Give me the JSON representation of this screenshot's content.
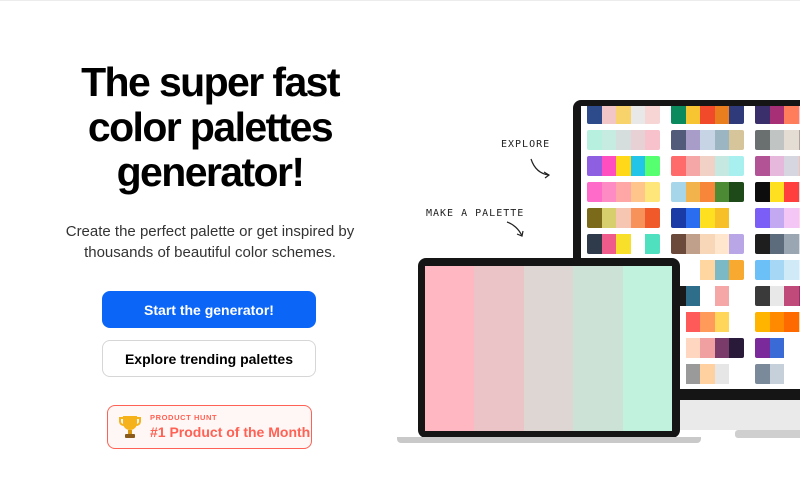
{
  "hero": {
    "title_lines": [
      "The super fast",
      "color palettes",
      "generator!"
    ],
    "subtitle_lines": [
      "Create the perfect palette or get inspired by",
      "thousands of beautiful color schemes."
    ]
  },
  "buttons": {
    "primary": "Start the generator!",
    "secondary": "Explore trending palettes"
  },
  "product_hunt": {
    "label": "PRODUCT HUNT",
    "title": "#1 Product of the Month"
  },
  "annotations": {
    "explore": "EXPLORE",
    "make": "MAKE A PALETTE"
  },
  "colors": {
    "primary_button": "#0b66f7",
    "product_hunt_accent": "#ff6154"
  },
  "laptop_palette": [
    "#ffb8c1",
    "#ebc4c8",
    "#ded6d2",
    "#cde2d7",
    "#c1f2de"
  ],
  "monitor_palettes": [
    [
      "#2d4a8a",
      "#f2c6c6",
      "#f8d26a",
      "#e8e8e8",
      "#f7d5d5"
    ],
    [
      "#0b8a5d",
      "#f7c532",
      "#f04a2a",
      "#e87e1e",
      "#2e3a7a"
    ],
    [
      "#3a2f6b",
      "#a72f75",
      "#ff7d5a",
      "#f0c7d7",
      "#ffe7a0"
    ],
    [
      "#b8f0e0",
      "#c6ece1",
      "#d5dedd",
      "#e8d1d5",
      "#f7c2cb"
    ],
    [
      "#525c7a",
      "#a89cc8",
      "#c6d4e6",
      "#9bb6c2",
      "#d6c49a"
    ],
    [
      "#6a7070",
      "#c0c5c4",
      "#e4ddd3",
      "#b2a39a",
      "#8d5a4c"
    ],
    [
      "#8e5fe0",
      "#ff4ec0",
      "#ffd81a",
      "#22c5e8",
      "#55ff70"
    ],
    [
      "#ff6b6b",
      "#f5a6a6",
      "#f1d0c5",
      "#c5e8e0",
      "#a8f0f0"
    ],
    [
      "#b25396",
      "#e6b9dc",
      "#d6d6e0",
      "#f3c2b7",
      "#f7eed0"
    ],
    [
      "#ff6bc9",
      "#ff8bc5",
      "#ffa6a6",
      "#ffc58a",
      "#ffe67a"
    ],
    [
      "#a6d6ea",
      "#f2b34d",
      "#f7863a",
      "#4c8a34",
      "#1e4a1a"
    ],
    [
      "#0d0d0d",
      "#ffe020",
      "#ff3e3e",
      "#d8d8d8",
      "#2e2e2e"
    ],
    [
      "#7a6a1a",
      "#d7cf6e",
      "#f6c6b3",
      "#f7925a",
      "#f05a2a"
    ],
    [
      "#1a3aa6",
      "#2a6df0",
      "#ffe020",
      "#f7c026",
      "#ffffff"
    ],
    [
      "#7b5ef5",
      "#c3a9f2",
      "#f3c6f5",
      "#ffd6f0",
      "#ff9ec9"
    ],
    [
      "#2f3a4a",
      "#ef5b8a",
      "#f8df2a",
      "#ffffff",
      "#4fe0c0"
    ],
    [
      "#6b4a3c",
      "#c0a08a",
      "#f8d6b8",
      "#ffe6cc",
      "#b9a6e6"
    ],
    [
      "#1e1e1e",
      "#5c6c7c",
      "#9aa6b2",
      "#d6dde3",
      "#ffffff"
    ],
    [
      "#ffffff",
      "#ffffff",
      "#ffb8c1",
      "#e0d6d2",
      "#c1f2de"
    ],
    [
      "#ffffff",
      "#ffffff",
      "#ffd6a0",
      "#7bb9c6",
      "#f7a930"
    ],
    [
      "#6ac0f7",
      "#a6d8f5",
      "#d0eaf7",
      "#e6f4fb",
      "#ffffff"
    ],
    [
      "#ffffff",
      "#ffffff",
      "#0b5a3a",
      "#e670a6",
      "#f3c0c0"
    ],
    [
      "#1a1a1a",
      "#2e6e8a",
      "#ffffff",
      "#f5a6a6",
      "#ffffff"
    ],
    [
      "#3a3a3a",
      "#e8e8e8",
      "#c04a7a",
      "#9e2a6a",
      "#ffffff"
    ],
    [
      "#ffffff",
      "#ffffff",
      "#f53a2a",
      "#f58a2a",
      "#ffd02a"
    ],
    [
      "#ffffff",
      "#ff5a5a",
      "#ff9a5a",
      "#ffd65a",
      "#ffffff"
    ],
    [
      "#ffb400",
      "#ff8a00",
      "#ff6a00",
      "#ffd6a0",
      "#ffffff"
    ],
    [
      "#ffffff",
      "#ffffff",
      "#ffc61a",
      "#2e4a9a",
      "#f7b0d0"
    ],
    [
      "#ffffff",
      "#ffd6c0",
      "#f0a0a0",
      "#7a3a6a",
      "#2a1a3a"
    ],
    [
      "#7a2a9a",
      "#3a6ad6",
      "#ffffff",
      "#ffffff",
      "#ffffff"
    ],
    [
      "#ffffff",
      "#ffffff",
      "#f0f0f0",
      "#9ae0f0",
      "#ffe6a0"
    ],
    [
      "#ffffff",
      "#9a9a9a",
      "#ffd0a0",
      "#e6e6e6",
      "#ffffff"
    ],
    [
      "#7a8a9a",
      "#c6d0da",
      "#ffffff",
      "#ffffff",
      "#ffffff"
    ]
  ]
}
